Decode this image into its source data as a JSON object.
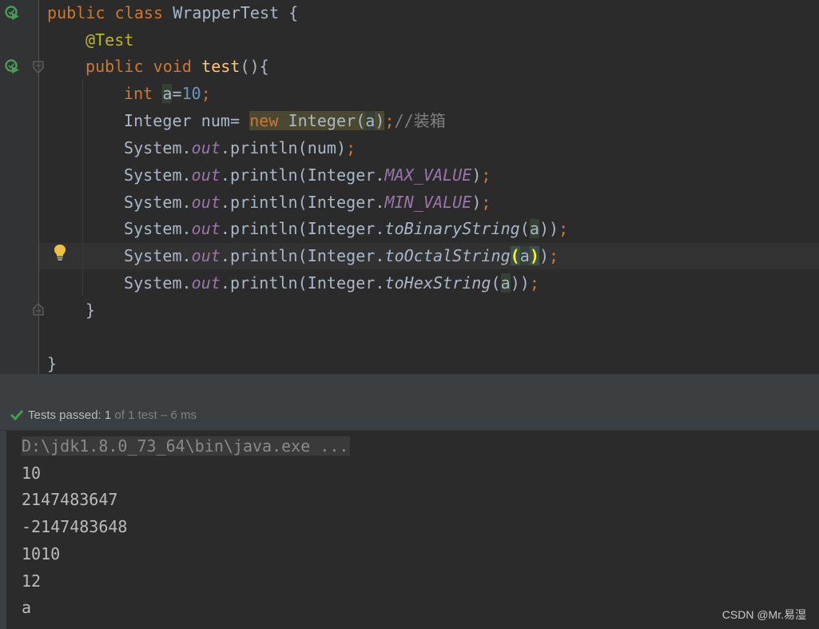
{
  "editor": {
    "lines": {
      "l1": {
        "kw1": "public ",
        "kw2": "class ",
        "rest": "WrapperTest {"
      },
      "l2": {
        "ann": "@Test"
      },
      "l3": {
        "kw1": "public ",
        "kw2": "void ",
        "fn": "test",
        "rest": "(){"
      },
      "l4": {
        "kw": "int ",
        "var": "a",
        "eq": "=",
        "num": "10",
        "semi": ";"
      },
      "l5": {
        "a": "Integer num= ",
        "new": "new ",
        "b": "Integer(",
        "param": "a",
        "c": ")",
        "semi": ";",
        "cmt": "//装箱"
      },
      "l6": {
        "a": "System.",
        "out": "out",
        "b": ".println(num)",
        "semi": ";"
      },
      "l7": {
        "a": "System.",
        "out": "out",
        "b": ".println(Integer.",
        "field": "MAX_VALUE",
        "c": ")",
        "semi": ";"
      },
      "l8": {
        "a": "System.",
        "out": "out",
        "b": ".println(Integer.",
        "field": "MIN_VALUE",
        "c": ")",
        "semi": ";"
      },
      "l9": {
        "a": "System.",
        "out": "out",
        "b": ".println(Integer.",
        "m": "toBinaryString",
        "open": "(",
        "param": "a",
        "c": "))",
        "semi": ";"
      },
      "l10": {
        "a": "System.",
        "out": "out",
        "b": ".println(Integer.",
        "m": "toOctalString",
        "open": "(",
        "param": "a",
        "close": ")",
        "c": ")",
        "semi": ";"
      },
      "l11": {
        "a": "System.",
        "out": "out",
        "b": ".println(Integer.",
        "m": "toHexString",
        "open": "(",
        "param": "a",
        "c": "))",
        "semi": ";"
      },
      "l12": {
        "text": "}"
      },
      "l14": {
        "text": "}"
      }
    }
  },
  "status": {
    "label": "Tests passed: 1",
    "detail": " of 1 test – 6 ms"
  },
  "console": {
    "command": "D:\\jdk1.8.0_73_64\\bin\\java.exe ...",
    "output": [
      "10",
      "2147483647",
      "-2147483648",
      "1010",
      "12",
      "a"
    ]
  },
  "watermark": "CSDN @Mr.易湿",
  "colors": {
    "keyword": "#cc7832",
    "annotation": "#bbb529",
    "function": "#ffc66d",
    "number": "#6897bb",
    "field": "#9876aa",
    "comment": "#808080",
    "pass_green": "#499c54"
  },
  "icons": [
    "run-test-icon",
    "fold-icon",
    "intention-bulb-icon",
    "check-icon"
  ]
}
